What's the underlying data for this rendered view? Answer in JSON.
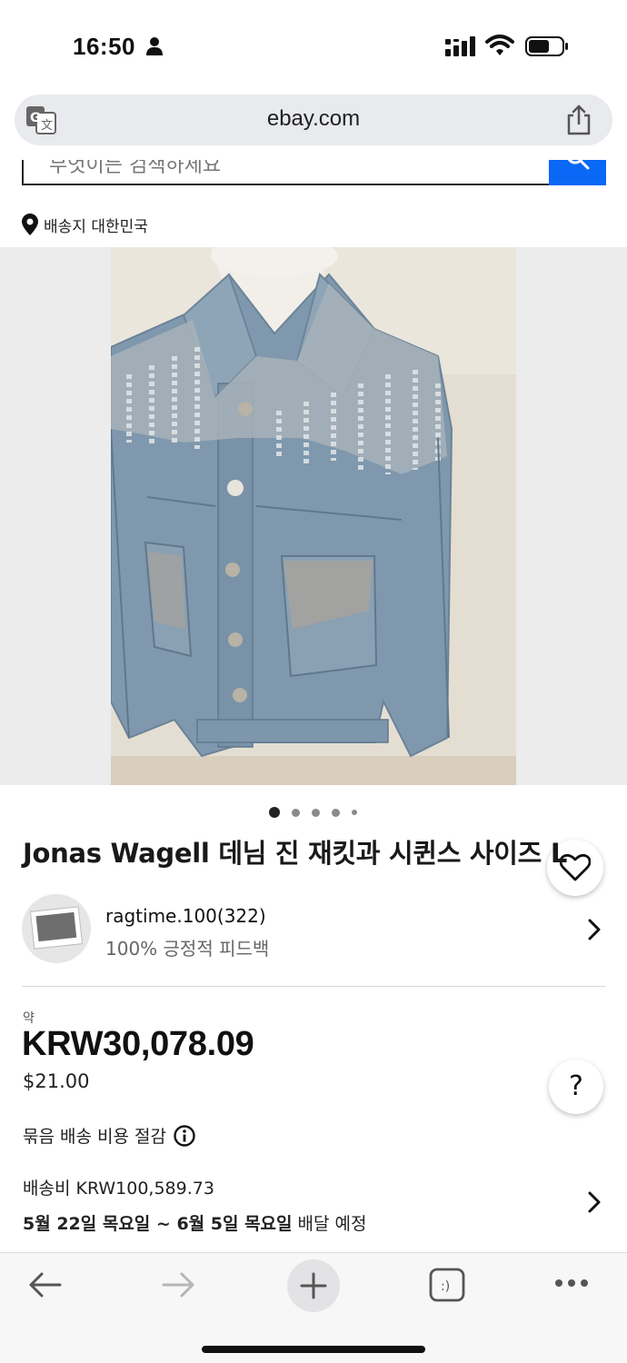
{
  "status_bar": {
    "time": "16:50"
  },
  "browser": {
    "url": "ebay.com"
  },
  "search": {
    "placeholder": "무엇이든 검색하세요"
  },
  "shipping_location": "배송지 대한민국",
  "gallery": {
    "image_count": 5,
    "active_index": 0
  },
  "product": {
    "title": "Jonas Wagell 데님 진 재킷과 시퀸스 사이즈 L"
  },
  "seller": {
    "name": "ragtime.100(322)",
    "feedback": "100% 긍정적 피드백"
  },
  "price": {
    "approx_label": "약",
    "krw": "KRW30,078.09",
    "usd": "$21.00"
  },
  "bundle_label": "묶음 배송 비용 절감",
  "shipping": {
    "cost": "배송비 KRW100,589.73",
    "delivery_date": "5월 22일 목요일 ~ 6월 5일 목요일",
    "delivery_suffix": " 배달 예정"
  },
  "help_label": "?",
  "icons": [
    "person-icon",
    "signal-icon",
    "wifi-icon",
    "battery-icon",
    "translate-icon",
    "share-icon",
    "search-icon",
    "pin-icon",
    "heart-icon",
    "chevron-right-icon",
    "info-icon",
    "back-icon",
    "forward-icon",
    "plus-icon",
    "tabs-icon",
    "more-icon"
  ],
  "colors": {
    "accent": "#0968f6"
  }
}
